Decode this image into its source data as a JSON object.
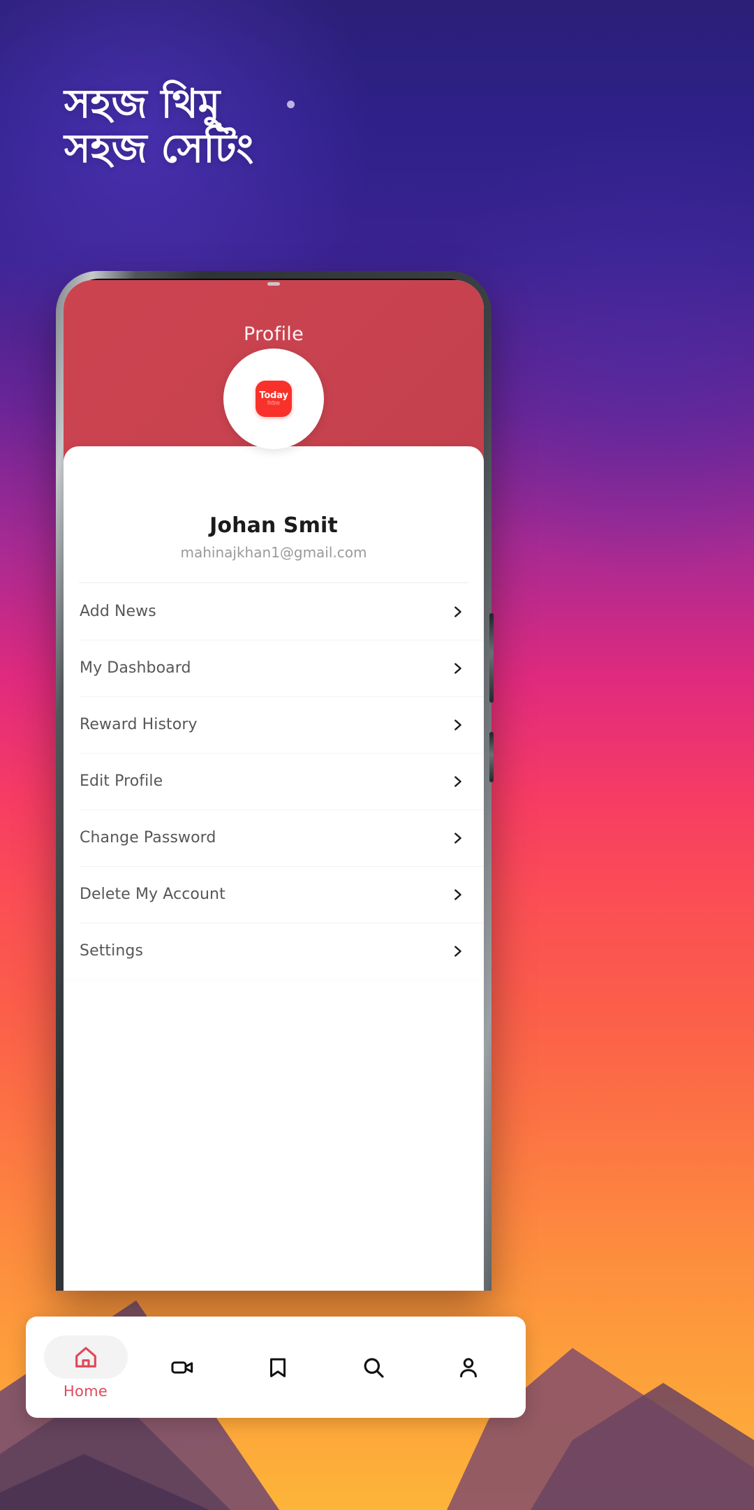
{
  "promo": {
    "headline_line1": "সহজ থিমু",
    "headline_line2": "সহজ সেটিং",
    "headline": "সহজ থিমু\nসহজ সেটিং",
    "accent_color": "#e0495a",
    "brand_red": "#f8312a",
    "header_red": "#c8434f",
    "background": "sunset-gradient-purple-to-orange"
  },
  "app": {
    "header": {
      "title": "Profile"
    },
    "avatar": {
      "logo_text": "Today",
      "logo_subtext": "নিউজ",
      "icon": "today-app-logo-icon"
    },
    "user": {
      "name": "Johan Smit",
      "email": "mahinajkhan1@gmail.com"
    },
    "menu": [
      {
        "label": "Add News",
        "chevron": "chevron-right-icon"
      },
      {
        "label": "My Dashboard",
        "chevron": "chevron-right-icon"
      },
      {
        "label": "Reward History",
        "chevron": "chevron-right-icon"
      },
      {
        "label": "Edit Profile",
        "chevron": "chevron-right-icon"
      },
      {
        "label": "Change Password",
        "chevron": "chevron-right-icon"
      },
      {
        "label": "Delete My Account",
        "chevron": "chevron-right-icon"
      },
      {
        "label": "Settings",
        "chevron": "chevron-right-icon"
      }
    ],
    "bottom_nav": {
      "items": [
        {
          "label": "Home",
          "icon": "home-icon",
          "active": true
        },
        {
          "label": "",
          "icon": "video-icon",
          "active": false
        },
        {
          "label": "",
          "icon": "bookmark-icon",
          "active": false
        },
        {
          "label": "",
          "icon": "search-icon",
          "active": false
        },
        {
          "label": "",
          "icon": "person-icon",
          "active": false
        }
      ]
    }
  }
}
